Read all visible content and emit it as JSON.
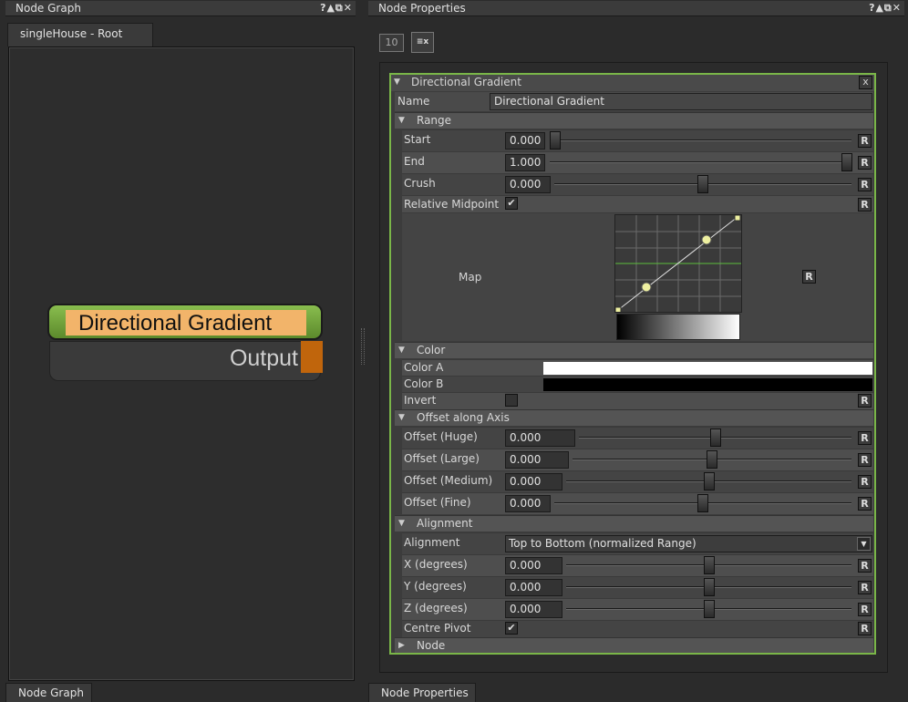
{
  "node_graph": {
    "panel_title": "Node Graph",
    "title_buttons": "?▲⧉✕",
    "tab_label": "singleHouse - Root",
    "bottom_tab": "Node Graph",
    "node": {
      "title": "Directional Gradient",
      "output_label": "Output"
    }
  },
  "properties": {
    "panel_title": "Node Properties",
    "title_buttons": "?▲⧉✕",
    "bottom_tab": "Node Properties",
    "toolbar": {
      "count": "10",
      "clear_icon": "≡x"
    },
    "node_header": "Directional Gradient",
    "close_label": "x",
    "name_label": "Name",
    "name_value": "Directional Gradient",
    "reset_label": "R",
    "sections": {
      "range": "Range",
      "color": "Color",
      "offset": "Offset along Axis",
      "alignment": "Alignment",
      "node": "Node"
    },
    "range": {
      "start": {
        "label": "Start",
        "value": "0.000",
        "slider": 0.0
      },
      "end": {
        "label": "End",
        "value": "1.000",
        "slider": 1.0
      },
      "crush": {
        "label": "Crush",
        "value": "0.000",
        "slider": 0.5
      },
      "relative_midpoint": {
        "label": "Relative Midpoint",
        "checked": true
      },
      "map_label": "Map"
    },
    "color": {
      "color_a": {
        "label": "Color A",
        "color": "#ffffff"
      },
      "color_b": {
        "label": "Color B",
        "color": "#000000"
      },
      "invert": {
        "label": "Invert",
        "checked": false
      }
    },
    "offset": {
      "huge": {
        "label": "Offset (Huge)",
        "value": "0.000",
        "slider": 0.5
      },
      "large": {
        "label": "Offset (Large)",
        "value": "0.000",
        "slider": 0.5
      },
      "medium": {
        "label": "Offset (Medium)",
        "value": "0.000",
        "slider": 0.5
      },
      "fine": {
        "label": "Offset (Fine)",
        "value": "0.000",
        "slider": 0.5
      }
    },
    "alignment": {
      "alignment": {
        "label": "Alignment",
        "value": "Top to Bottom (normalized Range)"
      },
      "x": {
        "label": "X (degrees)",
        "value": "0.000",
        "slider": 0.5
      },
      "y": {
        "label": "Y (degrees)",
        "value": "0.000",
        "slider": 0.5
      },
      "z": {
        "label": "Z (degrees)",
        "value": "0.000",
        "slider": 0.5
      },
      "centre_pivot": {
        "label": "Centre Pivot",
        "checked": true
      }
    }
  },
  "colors": {
    "accent_green": "#7ab648",
    "node_body": "#6e9a3a",
    "node_title_bg": "#f2b46a",
    "output_port": "#c0650c"
  }
}
